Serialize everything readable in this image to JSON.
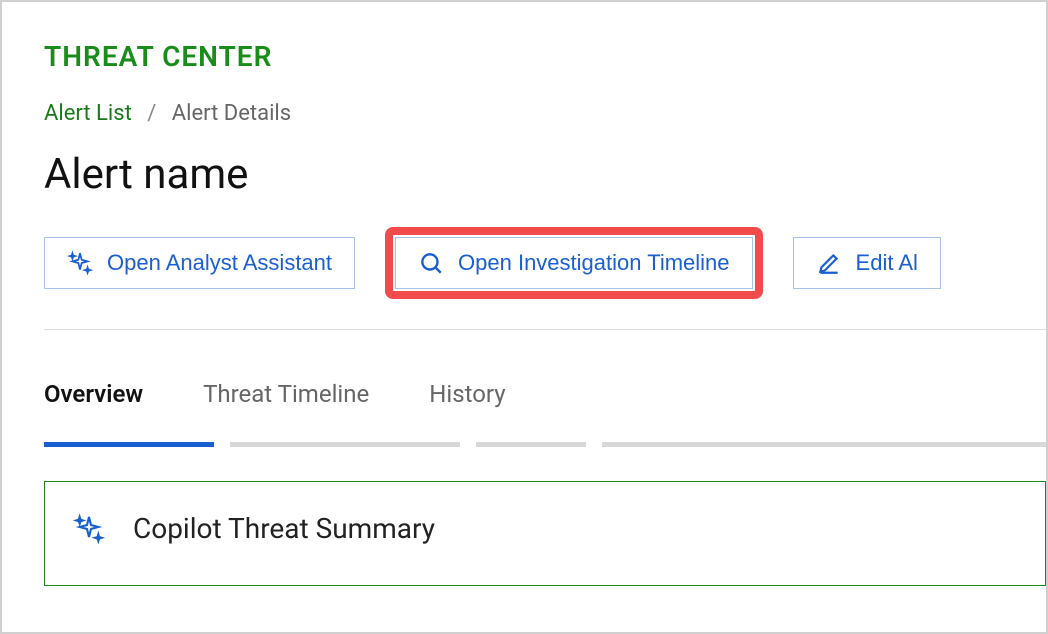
{
  "header": {
    "app_title": "THREAT CENTER"
  },
  "breadcrumb": {
    "link_label": "Alert List",
    "separator": "/",
    "current_label": "Alert Details"
  },
  "page": {
    "title": "Alert name"
  },
  "actions": {
    "analyst_assistant_label": "Open Analyst Assistant",
    "investigation_timeline_label": "Open Investigation Timeline",
    "edit_alert_label": "Edit Al"
  },
  "tabs": {
    "overview_label": "Overview",
    "threat_timeline_label": "Threat Timeline",
    "history_label": "History",
    "active": "overview"
  },
  "summary": {
    "title": "Copilot Threat Summary"
  },
  "colors": {
    "brand_green": "#1a8c1a",
    "action_blue": "#1a5fd0",
    "highlight_red": "#f14b4b"
  }
}
